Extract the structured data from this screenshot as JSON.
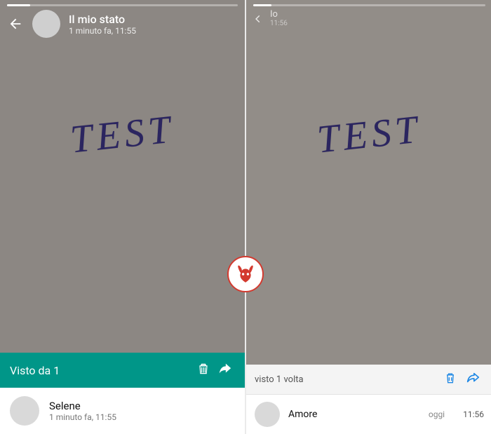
{
  "left": {
    "header": {
      "title": "Il mio stato",
      "subtitle": "1 minuto fa, 11:55"
    },
    "content_text": "TEST",
    "sheet": {
      "label": "Visto da 1",
      "viewer": {
        "name": "Selene",
        "time": "1 minuto fa, 11:55"
      }
    }
  },
  "right": {
    "header": {
      "title": "Io",
      "subtitle": "11:56"
    },
    "content_text": "TEST",
    "sheet": {
      "label": "visto 1 volta",
      "viewer": {
        "name": "Amore",
        "day": "oggi",
        "time": "11:56"
      }
    }
  },
  "colors": {
    "accent_teal": "#009688",
    "accent_blue": "#1e88e5",
    "watermark_red": "#d33a2f"
  }
}
